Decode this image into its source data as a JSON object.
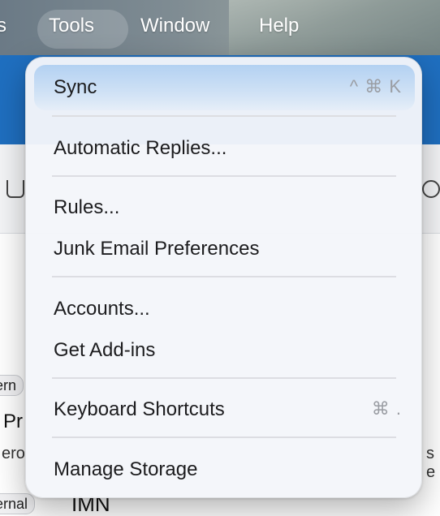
{
  "menubar": {
    "items": [
      {
        "label": "s"
      },
      {
        "label": "Tools"
      },
      {
        "label": "Window"
      },
      {
        "label": "Help"
      }
    ]
  },
  "background": {
    "tag1": "ern",
    "tag2": "ernal",
    "text_pr": "Pr",
    "text_ero": "ero",
    "text_se": "s e",
    "text_imn": "IMN"
  },
  "tools_menu": {
    "items": [
      {
        "label": "Sync",
        "shortcut": "^ ⌘ K",
        "selected": true
      },
      {
        "label": "Automatic Replies...",
        "shortcut": ""
      },
      {
        "label": "Rules...",
        "shortcut": ""
      },
      {
        "label": "Junk Email Preferences",
        "shortcut": ""
      },
      {
        "label": "Accounts...",
        "shortcut": ""
      },
      {
        "label": "Get Add-ins",
        "shortcut": ""
      },
      {
        "label": "Keyboard Shortcuts",
        "shortcut": "⌘ ."
      },
      {
        "label": "Manage Storage",
        "shortcut": ""
      }
    ]
  },
  "colors": {
    "app_accent": "#1f6fc0",
    "selected_item": "#b3d1f2",
    "menu_background": "#f4f6fa"
  }
}
